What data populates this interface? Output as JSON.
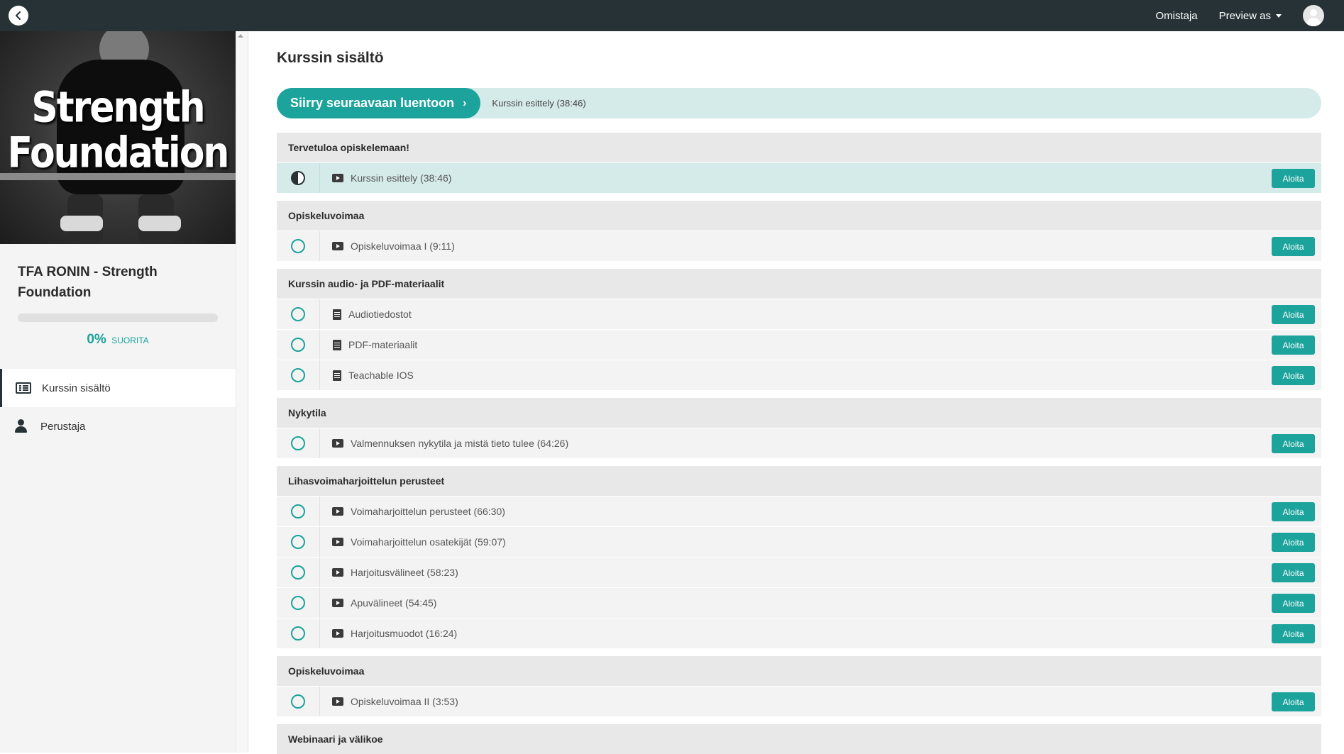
{
  "topbar": {
    "owner_label": "Omistaja",
    "preview_label": "Preview as"
  },
  "sidebar": {
    "image_text_line1": "Strength",
    "image_text_line2": "Foundation",
    "course_title": "TFA RONIN - Strength Foundation",
    "progress_percent": "0%",
    "progress_fraction": 0,
    "progress_label": "SUORITA",
    "nav": [
      {
        "label": "Kurssin sisältö",
        "icon": "list-icon",
        "active": true
      },
      {
        "label": "Perustaja",
        "icon": "person-icon",
        "active": false
      }
    ]
  },
  "main": {
    "title": "Kurssin sisältö",
    "next_button_label": "Siirry seuraavaan luentoon",
    "next_lecture": "Kurssin esittely (38:46)",
    "start_label": "Aloita",
    "sections": [
      {
        "title": "Tervetuloa opiskelemaan!",
        "lectures": [
          {
            "title": "Kurssin esittely (38:46)",
            "type": "video",
            "status": "in-progress"
          }
        ]
      },
      {
        "title": "Opiskeluvoimaa",
        "lectures": [
          {
            "title": "Opiskeluvoimaa I (9:11)",
            "type": "video",
            "status": "not-started"
          }
        ]
      },
      {
        "title": "Kurssin audio- ja PDF-materiaalit",
        "lectures": [
          {
            "title": "Audiotiedostot",
            "type": "document",
            "status": "not-started"
          },
          {
            "title": "PDF-materiaalit",
            "type": "document",
            "status": "not-started"
          },
          {
            "title": "Teachable IOS",
            "type": "document",
            "status": "not-started"
          }
        ]
      },
      {
        "title": "Nykytila",
        "lectures": [
          {
            "title": "Valmennuksen nykytila ja mistä tieto tulee (64:26)",
            "type": "video",
            "status": "not-started"
          }
        ]
      },
      {
        "title": "Lihasvoimaharjoittelun perusteet",
        "lectures": [
          {
            "title": "Voimaharjoittelun perusteet (66:30)",
            "type": "video",
            "status": "not-started"
          },
          {
            "title": "Voimaharjoittelun osatekijät (59:07)",
            "type": "video",
            "status": "not-started"
          },
          {
            "title": "Harjoitusvälineet (58:23)",
            "type": "video",
            "status": "not-started"
          },
          {
            "title": "Apuvälineet (54:45)",
            "type": "video",
            "status": "not-started"
          },
          {
            "title": "Harjoitusmuodot (16:24)",
            "type": "video",
            "status": "not-started"
          }
        ]
      },
      {
        "title": "Opiskeluvoimaa",
        "lectures": [
          {
            "title": "Opiskeluvoimaa II (3:53)",
            "type": "video",
            "status": "not-started"
          }
        ]
      },
      {
        "title": "Webinaari ja välikoe",
        "lectures": []
      }
    ]
  },
  "colors": {
    "topbar": "#263236",
    "accent": "#1ba39c",
    "accent_light": "#d5ebea"
  }
}
